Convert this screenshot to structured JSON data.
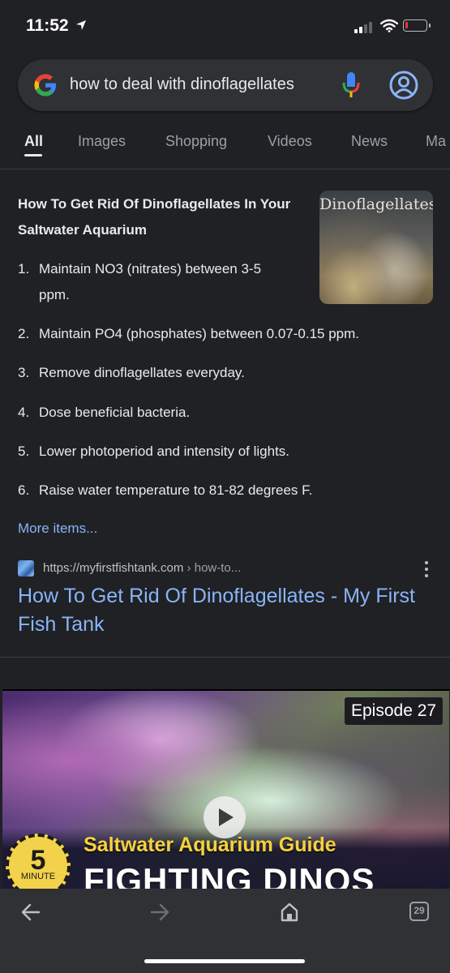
{
  "status_bar": {
    "time": "11:52"
  },
  "search": {
    "query": "how to deal with dinoflagellates",
    "icons": {
      "logo": "google-g-icon",
      "mic": "mic-icon",
      "account": "account-icon"
    }
  },
  "tabs": [
    {
      "label": "All",
      "active": true
    },
    {
      "label": "Images"
    },
    {
      "label": "Shopping"
    },
    {
      "label": "Videos"
    },
    {
      "label": "News"
    },
    {
      "label": "Ma"
    }
  ],
  "snippet": {
    "title": "How To Get Rid Of Dinoflagellates In Your Saltwater Aquarium",
    "thumbnail_text": "Dinoflagellates",
    "items": [
      {
        "num": "1.",
        "text": "Maintain NO3 (nitrates) between 3-5 ppm."
      },
      {
        "num": "2.",
        "text": "Maintain PO4 (phosphates) between 0.07-0.15 ppm."
      },
      {
        "num": "3.",
        "text": "Remove dinoflagellates everyday."
      },
      {
        "num": "4.",
        "text": "Dose beneficial bacteria."
      },
      {
        "num": "5.",
        "text": "Lower photoperiod and intensity of lights."
      },
      {
        "num": "6.",
        "text": "Raise water temperature to 81-82 degrees F."
      }
    ],
    "more_items": "More items..."
  },
  "result": {
    "url_domain": "https://myfirstfishtank.com",
    "url_path": " › how-to...",
    "title": "How To Get Rid Of Dinoflagellates - My First Fish Tank"
  },
  "video": {
    "episode": "Episode 27",
    "badge_number": "5",
    "badge_label": "MINUTE",
    "subtitle": "Saltwater Aquarium Guide",
    "headline": "FIGHTING DINOS"
  },
  "bottom_nav": {
    "tab_count": "29"
  },
  "colors": {
    "background": "#202124",
    "link": "#8ab4f8",
    "text": "#e8eaed"
  }
}
